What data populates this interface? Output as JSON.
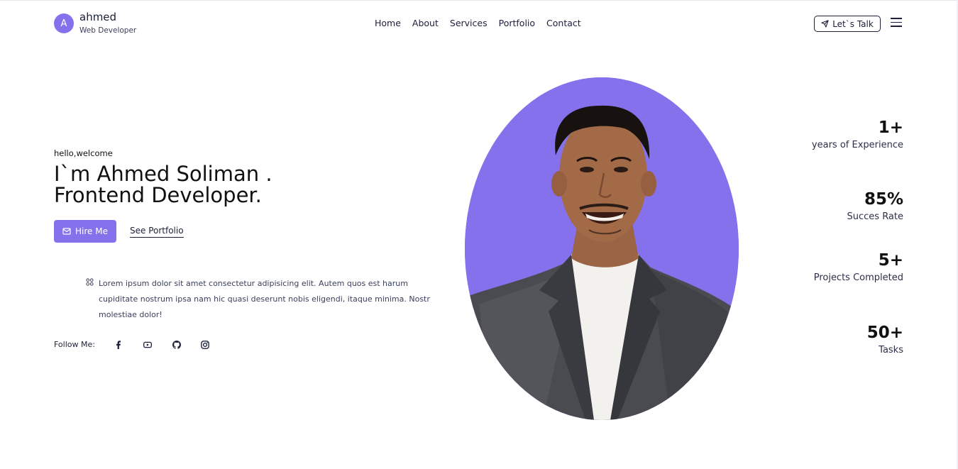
{
  "header": {
    "avatar_letter": "A",
    "name": "ahmed",
    "role": "Web Developer",
    "nav": [
      "Home",
      "About",
      "Services",
      "Portfolio",
      "Contact"
    ],
    "cta": "Let`s Talk"
  },
  "hero": {
    "greeting": "hello,welcome",
    "headline_line1": "I`m Ahmed Soliman .",
    "headline_line2": "Frontend Developer.",
    "hire_label": "Hire Me",
    "portfolio_label": "See Portfolio",
    "description": "Lorem ipsum dolor sit amet consectetur adipisicing elit. Autem quos est harum cupiditate nostrum ipsa nam hic quasi deserunt nobis eligendi, itaque minima. Nostr molestiae dolor!",
    "follow_label": "Follow Me:",
    "social_icons": [
      "facebook-icon",
      "youtube-icon",
      "github-icon",
      "instagram-icon"
    ]
  },
  "stats": [
    {
      "value": "1+",
      "label": "years of Experience"
    },
    {
      "value": "85%",
      "label": "Succes Rate"
    },
    {
      "value": "5+",
      "label": "Projects Completed"
    },
    {
      "value": "50+",
      "label": "Tasks"
    }
  ],
  "colors": {
    "accent": "#8571ec",
    "text": "#1b1f3b",
    "background": "#ffffff"
  }
}
